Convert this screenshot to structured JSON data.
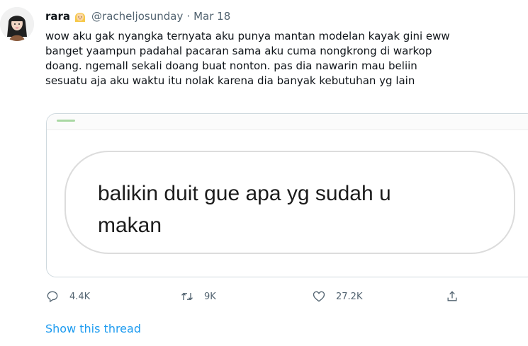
{
  "tweet": {
    "display_name": "rara",
    "name_emoji": "blonde-person-emoji",
    "handle": "@racheljosunday",
    "separator": "·",
    "date": "Mar 18",
    "text_lines": [
      "wow aku gak nyangka ternyata aku punya mantan modelan kayak gini eww",
      "banget yaampun padahal pacaran sama aku cuma nongkrong di warkop",
      "doang. ngemall sekali doang buat nonton. pas dia nawarin mau beliin",
      "sesuatu aja aku waktu itu nolak karena dia banyak kebutuhan yg lain"
    ]
  },
  "media": {
    "bubble_lines": [
      "balikin duit gue apa yg sudah u",
      "makan"
    ]
  },
  "actions": {
    "reply": {
      "icon": "reply-icon",
      "count": "4.4K"
    },
    "retweet": {
      "icon": "retweet-icon",
      "count": "9K"
    },
    "like": {
      "icon": "heart-icon",
      "count": "27.2K"
    },
    "share": {
      "icon": "share-icon"
    }
  },
  "thread_link": "Show this thread",
  "colors": {
    "link": "#1d9bf0",
    "secondary_text": "#536471",
    "primary_text": "#0f1419"
  }
}
